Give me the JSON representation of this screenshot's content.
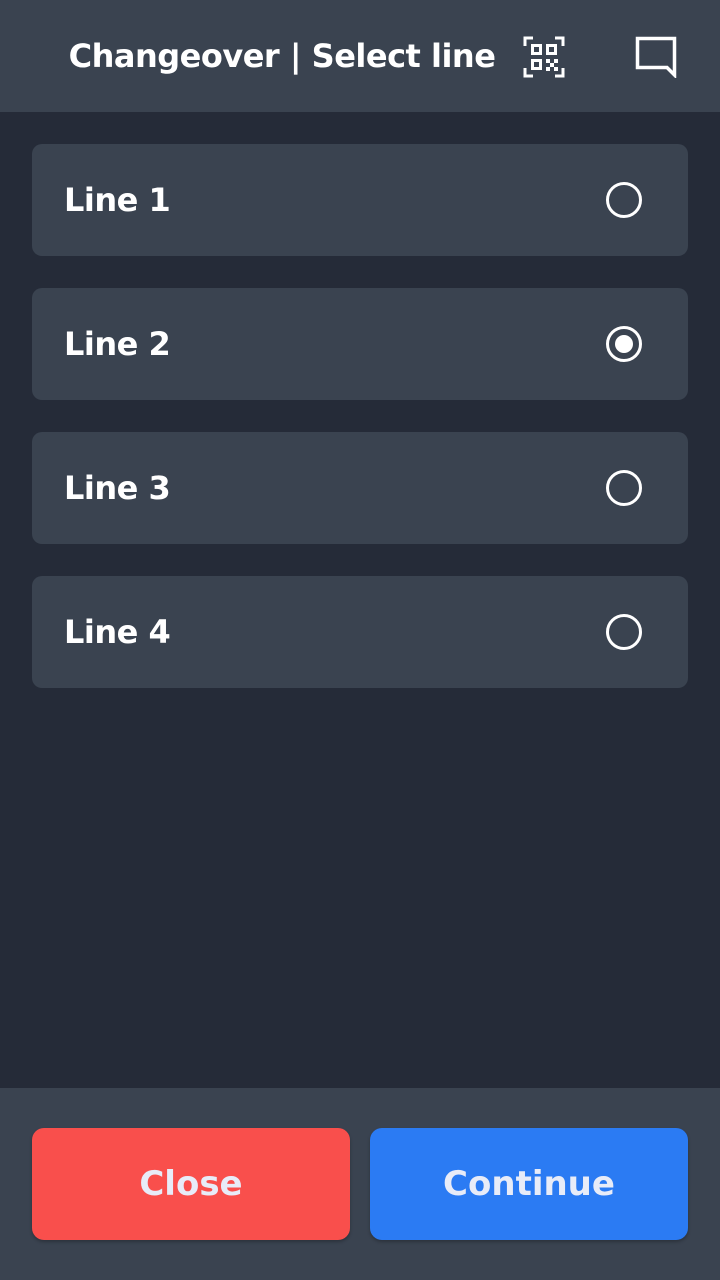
{
  "header": {
    "title": "Changeover | Select line",
    "icons": [
      "qr-code-icon",
      "chat-icon"
    ]
  },
  "lines": [
    {
      "label": "Line 1",
      "selected": false
    },
    {
      "label": "Line 2",
      "selected": true
    },
    {
      "label": "Line 3",
      "selected": false
    },
    {
      "label": "Line 4",
      "selected": false
    }
  ],
  "footer": {
    "close_label": "Close",
    "continue_label": "Continue"
  },
  "colors": {
    "background": "#252b38",
    "surface": "#3a4350",
    "close": "#f94f4c",
    "continue": "#2b7bf3"
  }
}
